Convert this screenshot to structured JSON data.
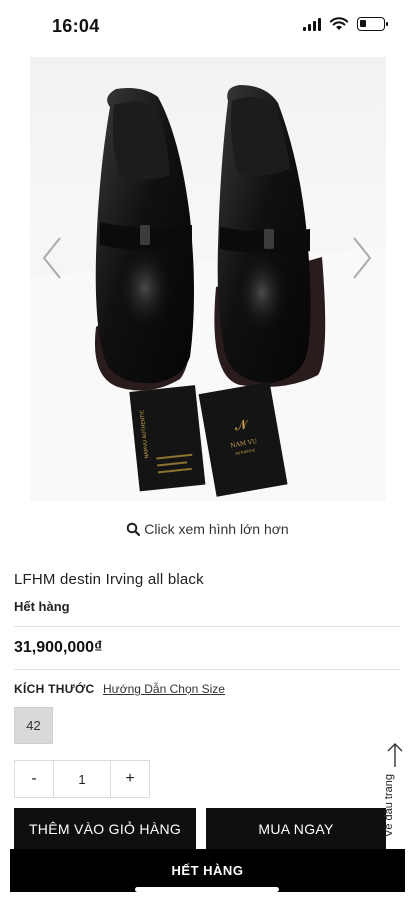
{
  "status_bar": {
    "time": "16:04",
    "battery_level": 0.3,
    "icons": [
      "signal-icon",
      "wifi-icon",
      "battery-icon"
    ]
  },
  "gallery": {
    "image_description_icon": "product-photo",
    "card_gold_text": "NAM VU",
    "card_gold_sub": "AUTHENTIC",
    "card_left_text": "NAMVU AUTHENTIC",
    "prev_icon": "chevron-left-icon",
    "next_icon": "chevron-right-icon"
  },
  "zoom": {
    "label": "Click xem hình lớn hơn",
    "icon": "search-icon"
  },
  "product": {
    "name": "LFHM destin Irving all black",
    "stock": "Hết hàng",
    "price": "31,900,000₫"
  },
  "size": {
    "label": "KÍCH THƯỚC",
    "guide": "Hướng Dẫn Chọn Size",
    "options": [
      "42"
    ]
  },
  "quantity": {
    "minus": "-",
    "value": "1",
    "plus": "+"
  },
  "actions": {
    "add_to_cart": "THÊM VÀO GIỎ HÀNG",
    "buy_now": "MUA NGAY",
    "back_to_top": "Về đầu trang",
    "sold_out": "HẾT HÀNG"
  },
  "colors": {
    "accent": "#000000",
    "gold": "#c9a34a",
    "card": "#141414",
    "size_bg": "#d9d9d9"
  }
}
